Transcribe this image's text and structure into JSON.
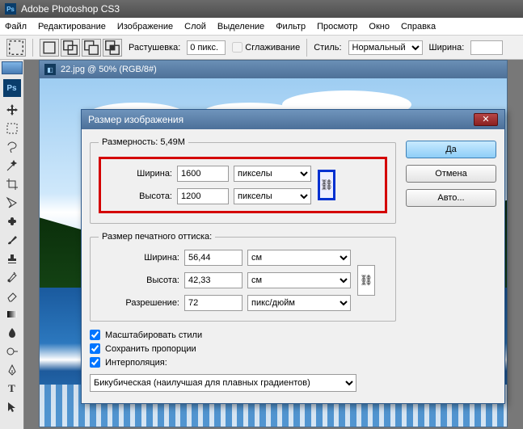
{
  "app": {
    "title": "Adobe Photoshop CS3",
    "logo_text": "Ps"
  },
  "menu": {
    "file": "Файл",
    "edit": "Редактирование",
    "image": "Изображение",
    "layer": "Слой",
    "select": "Выделение",
    "filter": "Фильтр",
    "view": "Просмотр",
    "window": "Окно",
    "help": "Справка"
  },
  "options": {
    "feather_label": "Растушевка:",
    "feather_value": "0 пикс.",
    "antialias_label": "Сглаживание",
    "style_label": "Стиль:",
    "style_value": "Нормальный",
    "width_label": "Ширина:"
  },
  "document": {
    "title": "22.jpg @ 50% (RGB/8#)"
  },
  "dialog": {
    "title": "Размер изображения",
    "dimensions_legend": "Размерность:  5,49M",
    "pixel": {
      "width_label": "Ширина:",
      "width_value": "1600",
      "height_label": "Высота:",
      "height_value": "1200",
      "unit": "пикселы"
    },
    "print_legend": "Размер печатного оттиска:",
    "print": {
      "width_label": "Ширина:",
      "width_value": "56,44",
      "height_label": "Высота:",
      "height_value": "42,33",
      "unit": "см",
      "res_label": "Разрешение:",
      "res_value": "72",
      "res_unit": "пикс/дюйм"
    },
    "scale_styles_label": "Масштабировать стили",
    "constrain_label": "Сохранить пропорции",
    "interpolation_label": "Интерполяция:",
    "interpolation_value": "Бикубическая (наилучшая для плавных градиентов)",
    "buttons": {
      "ok": "Да",
      "cancel": "Отмена",
      "auto": "Авто..."
    }
  }
}
